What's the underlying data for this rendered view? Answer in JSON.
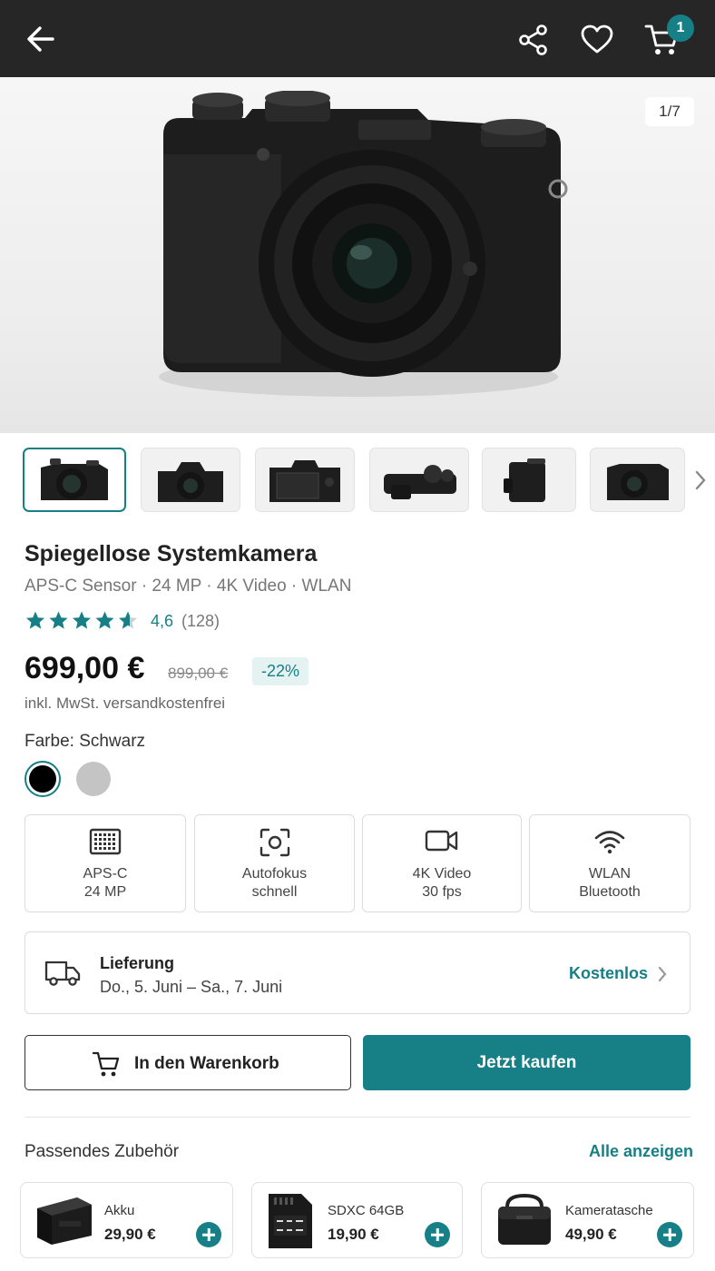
{
  "header": {
    "cart_count": "1"
  },
  "gallery": {
    "counter": "1/7"
  },
  "product": {
    "title": "Spiegellose Systemkamera",
    "subtitle": "APS-C Sensor · 24 MP · 4K Video · WLAN",
    "rating_stars": 4.6,
    "rating": "4,6",
    "reviews": "(128)",
    "price": "699,00 €",
    "old_price": "899,00 €",
    "discount": "-22%",
    "tax_note": "inkl. MwSt. versandkostenfrei",
    "color_label": "Farbe: Schwarz"
  },
  "features": [
    {
      "icon": "sensor-grid-icon",
      "line1": "APS-C",
      "line2": "24 MP"
    },
    {
      "icon": "autofocus-icon",
      "line1": "Autofokus",
      "line2": "schnell"
    },
    {
      "icon": "video-camera-icon",
      "line1": "4K Video",
      "line2": "30 fps"
    },
    {
      "icon": "wifi-icon",
      "line1": "WLAN",
      "line2": "Bluetooth"
    }
  ],
  "delivery": {
    "title": "Lieferung",
    "date": "Do., 5. Juni – Sa., 7. Juni",
    "price": "Kostenlos"
  },
  "actions": {
    "add_to_cart": "In den Warenkorb",
    "buy_now": "Jetzt kaufen"
  },
  "accessories": {
    "title": "Passendes Zubehör",
    "view_all": "Alle anzeigen",
    "items": [
      {
        "name": "Akku",
        "price": "29,90 €"
      },
      {
        "name": "SDXC 64GB",
        "price": "19,90 €"
      },
      {
        "name": "Kameratasche",
        "price": "49,90 €"
      }
    ]
  },
  "colors": {
    "accent": "#177f86",
    "topbar": "#262626",
    "swatch_black": "#000000",
    "swatch_grey": "#c4c4c4"
  }
}
